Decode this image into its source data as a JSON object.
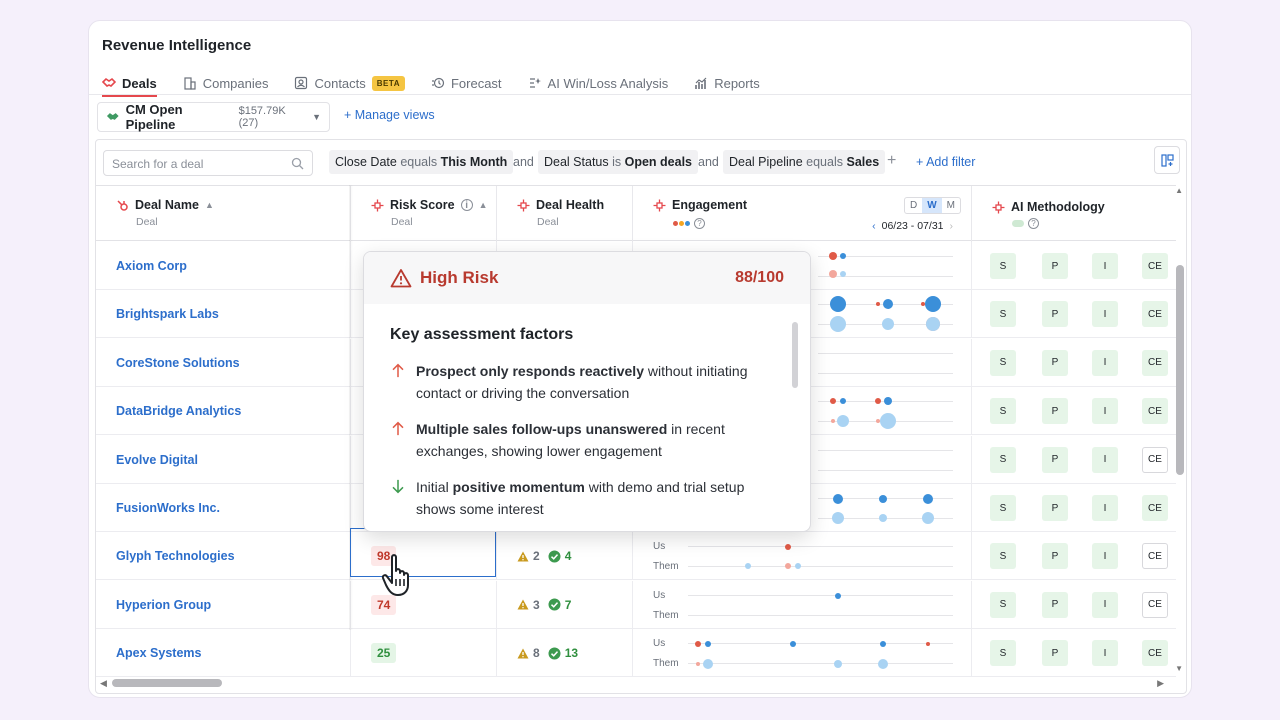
{
  "app": {
    "title": "Revenue Intelligence"
  },
  "tabs": [
    {
      "label": "Deals",
      "icon": "handshake-icon",
      "active": true
    },
    {
      "label": "Companies",
      "icon": "building-icon"
    },
    {
      "label": "Contacts",
      "icon": "contact-card-icon",
      "badge": "BETA"
    },
    {
      "label": "Forecast",
      "icon": "forecast-icon"
    },
    {
      "label": "AI Win/Loss Analysis",
      "icon": "ai-analysis-icon"
    },
    {
      "label": "Reports",
      "icon": "reports-icon"
    }
  ],
  "pipeline": {
    "name": "CM Open Pipeline",
    "meta": "$157.79K (27)"
  },
  "manage_views": "+ Manage views",
  "search": {
    "placeholder": "Search for a deal"
  },
  "filters": [
    {
      "field": "Close Date",
      "op": "equals",
      "value": "This Month"
    },
    {
      "field": "Deal Status",
      "op": "is",
      "value": "Open deals"
    },
    {
      "field": "Deal Pipeline",
      "op": "equals",
      "value": "Sales"
    }
  ],
  "filter_joiner": "and",
  "add_filter": "+ Add filter",
  "columns": {
    "deal_name": {
      "title": "Deal Name",
      "sub": "Deal"
    },
    "risk_score": {
      "title": "Risk Score",
      "sub": "Deal"
    },
    "deal_health": {
      "title": "Deal Health",
      "sub": "Deal"
    },
    "engagement": {
      "title": "Engagement",
      "range": "06/23 - 07/31",
      "periods": [
        "D",
        "W",
        "M"
      ],
      "active_period": "W"
    },
    "ai_methodology": {
      "title": "AI Methodology"
    }
  },
  "engagement_labels": {
    "us": "Us",
    "them": "Them"
  },
  "methodology_letters": [
    "S",
    "P",
    "I",
    "CE"
  ],
  "rows": [
    {
      "name": "Axiom Corp"
    },
    {
      "name": "Brightspark Labs"
    },
    {
      "name": "CoreStone Solutions"
    },
    {
      "name": "DataBridge Analytics"
    },
    {
      "name": "Evolve Digital"
    },
    {
      "name": "FusionWorks Inc."
    },
    {
      "name": "Glyph Technologies",
      "risk": "98",
      "risk_level": "high",
      "warn": "2",
      "ok": "4"
    },
    {
      "name": "Hyperion Group",
      "risk": "74",
      "risk_level": "high",
      "warn": "3",
      "ok": "7"
    },
    {
      "name": "Apex Systems",
      "risk": "25",
      "risk_level": "low",
      "warn": "8",
      "ok": "13"
    }
  ],
  "popover": {
    "title": "High Risk",
    "score": "88/100",
    "heading": "Key assessment factors",
    "factors": [
      {
        "direction": "up",
        "bold": "Prospect only responds reactively",
        "rest": " without initiating contact or driving the conversation"
      },
      {
        "direction": "up",
        "bold": "Multiple sales follow-ups unanswered",
        "rest": " in recent exchanges, showing lower engagement"
      },
      {
        "direction": "down",
        "pre": "Initial ",
        "bold": "positive momentum",
        "rest": " with demo and trial setup shows some interest"
      }
    ]
  },
  "colors": {
    "accent": "#2c6ecb",
    "risk_high": "#c0392b",
    "risk_low": "#2f8f3e",
    "us_dot": "#e05a47",
    "them_dot": "#3b8fd9"
  }
}
